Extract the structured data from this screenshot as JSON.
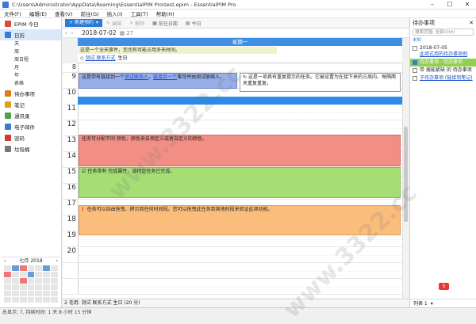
{
  "window": {
    "title": "C:\\Users\\Administrator\\AppData\\Roaming\\EssentialPIM Pro\\test.epim - EssentialPIM Pro",
    "min": "–",
    "max": "☐",
    "close": "✕"
  },
  "menu": [
    "文件(F)",
    "编辑(E)",
    "查看(V)",
    "前往(G)",
    "插入(I)",
    "工具(T)",
    "帮助(H)"
  ],
  "sidebar": {
    "items": [
      {
        "label": "EPIM 今日",
        "icon": "today-icon",
        "color": "#e04a3a"
      },
      {
        "label": "日历",
        "icon": "calendar-icon",
        "color": "#3a7bd5"
      }
    ],
    "cal_subs": [
      "天",
      "周",
      "周日程",
      "月",
      "年",
      "表格"
    ],
    "more": [
      {
        "label": "待办事项",
        "icon": "todo-icon",
        "color": "#e07a1a"
      },
      {
        "label": "笔记",
        "icon": "notes-icon",
        "color": "#e0a11a"
      },
      {
        "label": "通讯录",
        "icon": "contacts-icon",
        "color": "#4aa54a"
      },
      {
        "label": "电子邮件",
        "icon": "mail-icon",
        "color": "#3a7bd5"
      },
      {
        "label": "密码",
        "icon": "password-icon",
        "color": "#d23a3a"
      },
      {
        "label": "垃圾桶",
        "icon": "trash-icon",
        "color": "#777777"
      }
    ],
    "minical": {
      "month": "七月",
      "year": "2018"
    }
  },
  "toolbar": {
    "new_label": "新建预约",
    "edit_label": "编辑",
    "delete_label": "删除",
    "goto_label": "前往日期",
    "today_label": "今日"
  },
  "datebar": {
    "date": "2018-07-02",
    "week": "27"
  },
  "day": {
    "header": "星期一",
    "allday1": "这是一个全天事件，您也有可能占用多天时间。",
    "allday2_link1": "测试 联系方式",
    "allday2_rest": "生日",
    "hours": [
      "8",
      "9",
      "10",
      "11",
      "12",
      "13",
      "14",
      "15",
      "16",
      "17",
      "18",
      "19",
      "20"
    ]
  },
  "events": {
    "ev1_pre": "这是带有链接到一个",
    "ev1_link1": "测试联系人",
    "ev1_link2": "链接另一个",
    "ev1_post": "事可并由测试联络人。",
    "ev2": "这是一项具有重复提示的任务。它被设置为在接下来的三周内、每隔两天重复重复。",
    "ev3": "任务可分配不同 颜色，颜色来自预定义或者自定义的颜色。",
    "ev4": "任务带有 完成属性，该特定任务已完成。",
    "ev5": "任务可以自由拖曳、拷贝到任何时间段。您可以拖曳此任务到其他时段来验证此项功能。"
  },
  "status_line": "2 毛用: 测试 联系方式 生日 (20 分)",
  "statusbar": "总显示: 7, 持续时间: 1 天 8 小时 15 分钟",
  "right_panel": {
    "title": "待办事项",
    "search_placeholder": "搜索范围: 全部(Ctrl)",
    "group_label": "未知",
    "items": [
      {
        "date": "2018-07-05",
        "text": "此项式用的待办事项例"
      },
      {
        "text": "待办事项 - 待办事项",
        "selected": true
      },
      {
        "text": "带 搜能紧缺 的 待办事项"
      },
      {
        "text": "子待办事项 (链接到笔记)"
      }
    ],
    "footer": "列表 1",
    "badge": "S"
  },
  "watermark": "www.3322.cc"
}
